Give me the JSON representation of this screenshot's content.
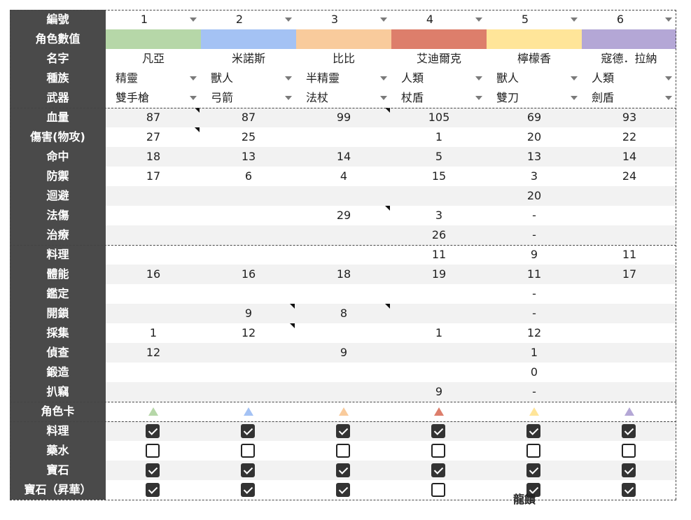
{
  "labels": {
    "id": "編號",
    "color": "角色數值",
    "name": "名字",
    "race": "種族",
    "weapon": "武器",
    "hp": "血量",
    "atk": "傷害(物攻)",
    "hit": "命中",
    "def": "防禦",
    "eva": "迴避",
    "matk": "法傷",
    "heal": "治療",
    "cook": "料理",
    "stamina": "體能",
    "appraise": "鑑定",
    "unlock": "開鎖",
    "gather": "採集",
    "scout": "偵查",
    "forge": "鍛造",
    "steal": "扒竊",
    "card": "角色卡",
    "chk_cook": "料理",
    "chk_potion": "藥水",
    "chk_gem": "寶石",
    "chk_gem_up": "寶石（昇華）"
  },
  "characters": [
    {
      "id": "1",
      "color": "#b6d7a8",
      "name": "凡亞",
      "race": "精靈",
      "weapon": "雙手槍",
      "hp": "87",
      "atk": "27",
      "hit": "18",
      "def": "17",
      "eva": "",
      "matk": "",
      "heal": "",
      "cook": "",
      "stamina": "16",
      "appraise": "",
      "unlock": "",
      "gather": "1",
      "scout": "12",
      "forge": "",
      "steal": "",
      "checks": [
        true,
        false,
        true,
        true
      ]
    },
    {
      "id": "2",
      "color": "#a4c2f4",
      "name": "米諾斯",
      "race": "獸人",
      "weapon": "弓箭",
      "hp": "87",
      "atk": "25",
      "hit": "13",
      "def": "6",
      "eva": "",
      "matk": "",
      "heal": "",
      "cook": "",
      "stamina": "16",
      "appraise": "",
      "unlock": "9",
      "gather": "12",
      "scout": "",
      "forge": "",
      "steal": "",
      "checks": [
        true,
        false,
        true,
        true
      ]
    },
    {
      "id": "3",
      "color": "#f9cb9c",
      "name": "比比",
      "race": "半精靈",
      "weapon": "法杖",
      "hp": "99",
      "atk": "",
      "hit": "14",
      "def": "4",
      "eva": "",
      "matk": "29",
      "heal": "",
      "cook": "",
      "stamina": "18",
      "appraise": "",
      "unlock": "8",
      "gather": "",
      "scout": "9",
      "forge": "",
      "steal": "",
      "checks": [
        true,
        false,
        true,
        true
      ]
    },
    {
      "id": "4",
      "color": "#dd7e6b",
      "name": "艾迪爾克",
      "race": "人類",
      "weapon": "杖盾",
      "hp": "105",
      "atk": "1",
      "hit": "5",
      "def": "15",
      "eva": "",
      "matk": "3",
      "heal": "26",
      "cook": "11",
      "stamina": "19",
      "appraise": "",
      "unlock": "",
      "gather": "1",
      "scout": "",
      "forge": "",
      "steal": "9",
      "checks": [
        true,
        false,
        true,
        false
      ]
    },
    {
      "id": "5",
      "color": "#ffe599",
      "name": "檸檬香",
      "race": "獸人",
      "weapon": "雙刀",
      "hp": "69",
      "atk": "20",
      "hit": "13",
      "def": "3",
      "eva": "20",
      "matk": "-",
      "heal": "-",
      "cook": "9",
      "stamina": "11",
      "appraise": "-",
      "unlock": "-",
      "gather": "12",
      "scout": "1",
      "forge": "0",
      "steal": "-",
      "checks": [
        true,
        false,
        true,
        true
      ]
    },
    {
      "id": "6",
      "color": "#b4a7d6",
      "name": "寇德．拉納",
      "race": "人類",
      "weapon": "劍盾",
      "hp": "93",
      "atk": "22",
      "hit": "14",
      "def": "24",
      "eva": "",
      "matk": "",
      "heal": "",
      "cook": "11",
      "stamina": "17",
      "appraise": "",
      "unlock": "",
      "gather": "",
      "scout": "",
      "forge": "",
      "steal": "",
      "checks": [
        true,
        false,
        true,
        true
      ]
    }
  ],
  "footnote": "龍饋",
  "colors": {
    "label_bg": "#4a4a4a",
    "shade": "#f2f2f2",
    "check": "#333333"
  }
}
